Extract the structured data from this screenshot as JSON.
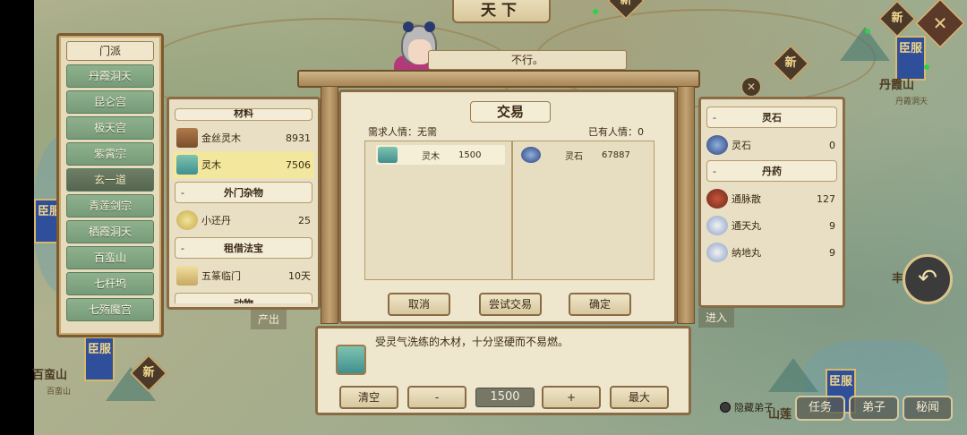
{
  "map": {
    "title": "天下",
    "places": [
      "丹霞山",
      "丹霞洞天",
      "百蛮山",
      "百蛮山",
      "丰",
      "山莲"
    ],
    "new_badge": "新",
    "flag_text": "臣服",
    "close_label": "✕",
    "back_label": "↶"
  },
  "sect_list": {
    "header": "门派",
    "items": [
      "丹霞洞天",
      "昆仑宫",
      "极天宫",
      "紫霄宗",
      "玄一道",
      "青莲剑宗",
      "栖霞洞天",
      "百蛮山",
      "七杆坞",
      "七殇魔宫"
    ],
    "selected": "玄一道"
  },
  "npc": {
    "speech": "不行。"
  },
  "inventory": {
    "top_category_partial": "材料",
    "items": [
      {
        "name": "金丝灵木",
        "count": "8931",
        "icon": "wood-icon"
      },
      {
        "name": "灵木",
        "count": "7506",
        "icon": "spirit-wood-icon",
        "selected": true
      }
    ],
    "category2": "外门杂物",
    "items2": [
      {
        "name": "小还丹",
        "count": "25",
        "icon": "pill-icon"
      }
    ],
    "category3": "租借法宝",
    "items3": [
      {
        "name": "五篆临门",
        "count": "10天",
        "icon": "scroll-icon"
      }
    ],
    "bottom_category_partial": "动物",
    "dash": "-"
  },
  "side_labels": {
    "output": "产出",
    "enter": "进入"
  },
  "trade": {
    "title": "交易",
    "need_label": "需求人情：无需",
    "have_label": "已有人情：0",
    "offer": {
      "name": "灵木",
      "count": "1500"
    },
    "receive": {
      "name": "灵石",
      "count": "67887"
    },
    "buttons": {
      "cancel": "取消",
      "try": "尝试交易",
      "confirm": "确定"
    }
  },
  "resources": {
    "dash": "-",
    "category1": "灵石",
    "items1": [
      {
        "name": "灵石",
        "count": "0",
        "icon": "spirit-stone-icon"
      }
    ],
    "category2": "丹药",
    "items2": [
      {
        "name": "通脉散",
        "count": "127",
        "icon": "powder-bowl-icon"
      },
      {
        "name": "通天丸",
        "count": "9",
        "icon": "gourd-icon"
      },
      {
        "name": "纳地丸",
        "count": "9",
        "icon": "gourd-icon"
      }
    ]
  },
  "description": {
    "text": "受灵气洗练的木材，十分坚硬而不易燃。",
    "clear": "清空",
    "minus": "-",
    "quantity": "1500",
    "plus": "+",
    "max": "最大"
  },
  "bottom_bar": {
    "hide_disciples": "隐藏弟子",
    "tasks": "任务",
    "disciples": "弟子",
    "secrets": "秘闻"
  },
  "colors": {
    "panel_bg": "#e8dfc4",
    "border": "#8a6b44",
    "sect_green": "#779a78",
    "selected_row": "#f2e79c"
  }
}
